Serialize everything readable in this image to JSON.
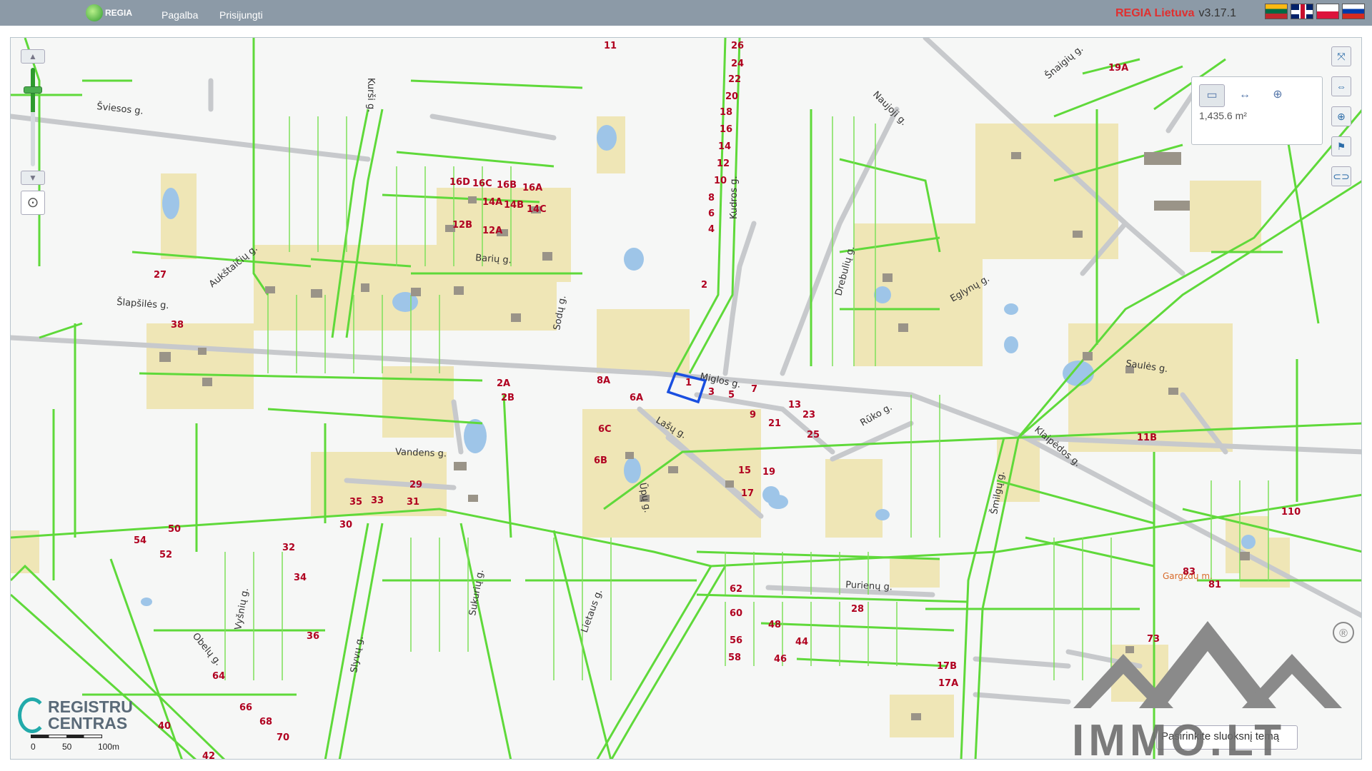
{
  "header": {
    "logo_text": "REGIA",
    "nav": [
      {
        "label": "Pagalba"
      },
      {
        "label": "Prisijungti"
      }
    ],
    "brand": "REGIA Lietuva",
    "version": "v3.17.1",
    "languages": [
      {
        "code": "lt",
        "icon": "lt-flag-icon"
      },
      {
        "code": "en",
        "icon": "en-flag-icon"
      },
      {
        "code": "pl",
        "icon": "pl-flag-icon"
      },
      {
        "code": "ru",
        "icon": "ru-flag-icon"
      }
    ]
  },
  "measure": {
    "value": "1,435.6 m²",
    "tools": [
      "area-measure-icon",
      "distance-measure-icon",
      "point-measure-icon"
    ]
  },
  "right_tools": [
    "fullscreen-icon",
    "measure-icon",
    "xy-icon",
    "flag-icon",
    "link-icon"
  ],
  "map": {
    "streets": [
      {
        "name": "Šviesos g."
      },
      {
        "name": "Kurši g."
      },
      {
        "name": "Aukštaičių g."
      },
      {
        "name": "Barių g."
      },
      {
        "name": "Šlapšilės g."
      },
      {
        "name": "Sodų g."
      },
      {
        "name": "Kudros g."
      },
      {
        "name": "Naujoji g."
      },
      {
        "name": "Šnaigių g."
      },
      {
        "name": "Drebulių g."
      },
      {
        "name": "Eglynų g."
      },
      {
        "name": "Miglos g."
      },
      {
        "name": "Lašų g."
      },
      {
        "name": "Rūko g."
      },
      {
        "name": "Klaipėdos g."
      },
      {
        "name": "Saulės g."
      },
      {
        "name": "Vandens g."
      },
      {
        "name": "Ūpų g."
      },
      {
        "name": "Šmilgų g."
      },
      {
        "name": "Purienų g."
      },
      {
        "name": "Sukurių g."
      },
      {
        "name": "Lietaus g."
      },
      {
        "name": "Vyšnių g."
      },
      {
        "name": "Slyvų g."
      },
      {
        "name": "Obelų g."
      }
    ],
    "place_label": "Gargždų m.",
    "parcel_numbers": [
      {
        "text": "11"
      },
      {
        "text": "26"
      },
      {
        "text": "24"
      },
      {
        "text": "22"
      },
      {
        "text": "20"
      },
      {
        "text": "18"
      },
      {
        "text": "16"
      },
      {
        "text": "14"
      },
      {
        "text": "12"
      },
      {
        "text": "10"
      },
      {
        "text": "8"
      },
      {
        "text": "6"
      },
      {
        "text": "4"
      },
      {
        "text": "2"
      },
      {
        "text": "1"
      },
      {
        "text": "3"
      },
      {
        "text": "5"
      },
      {
        "text": "7"
      },
      {
        "text": "9"
      },
      {
        "text": "13"
      },
      {
        "text": "15"
      },
      {
        "text": "17"
      },
      {
        "text": "19"
      },
      {
        "text": "21"
      },
      {
        "text": "23"
      },
      {
        "text": "25"
      },
      {
        "text": "8A"
      },
      {
        "text": "6A"
      },
      {
        "text": "6C"
      },
      {
        "text": "6B"
      },
      {
        "text": "2A"
      },
      {
        "text": "2B"
      },
      {
        "text": "12A"
      },
      {
        "text": "12B"
      },
      {
        "text": "14A"
      },
      {
        "text": "14B"
      },
      {
        "text": "14C"
      },
      {
        "text": "16A"
      },
      {
        "text": "16B"
      },
      {
        "text": "16C"
      },
      {
        "text": "16D"
      },
      {
        "text": "19A"
      },
      {
        "text": "17B"
      },
      {
        "text": "17A"
      },
      {
        "text": "11B"
      },
      {
        "text": "110"
      },
      {
        "text": "38"
      },
      {
        "text": "36"
      },
      {
        "text": "34"
      },
      {
        "text": "32"
      },
      {
        "text": "30"
      },
      {
        "text": "28"
      },
      {
        "text": "27"
      },
      {
        "text": "29"
      },
      {
        "text": "31"
      },
      {
        "text": "33"
      },
      {
        "text": "35"
      },
      {
        "text": "50"
      },
      {
        "text": "52"
      },
      {
        "text": "54"
      },
      {
        "text": "56"
      },
      {
        "text": "58"
      },
      {
        "text": "60"
      },
      {
        "text": "62"
      },
      {
        "text": "64"
      },
      {
        "text": "66"
      },
      {
        "text": "68"
      },
      {
        "text": "70"
      },
      {
        "text": "40"
      },
      {
        "text": "42"
      },
      {
        "text": "44"
      },
      {
        "text": "46"
      },
      {
        "text": "48"
      },
      {
        "text": "73"
      },
      {
        "text": "81"
      },
      {
        "text": "83"
      }
    ]
  },
  "logo": {
    "line1": "REGISTRU",
    "line2": "CENTRAS"
  },
  "scale": {
    "labels": [
      "0",
      "50",
      "100m"
    ]
  },
  "background_selector": {
    "value": "Pasirinkite sluoksnį temą"
  },
  "watermark": {
    "text": "IMMO.LT",
    "mark": "®"
  },
  "colors": {
    "parcel_border": "#5fd93a",
    "parcel_number": "#b00020",
    "road": "#c7c9cc",
    "residential_fill": "#efe6b6",
    "selected_parcel": "#1a4fe0",
    "water": "#9ec5e8"
  }
}
